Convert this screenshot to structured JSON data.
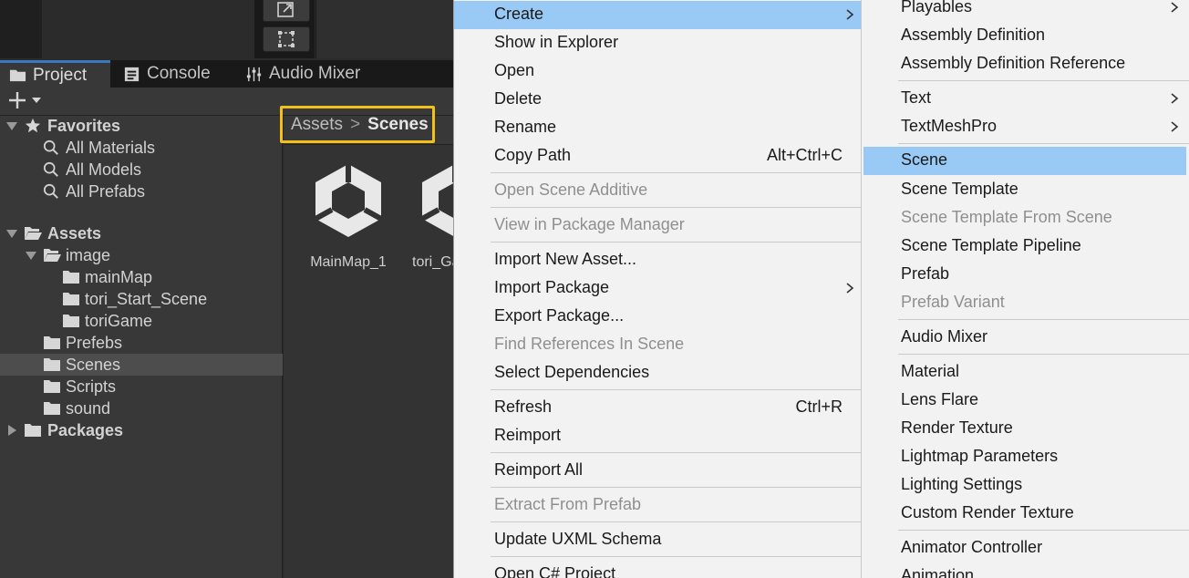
{
  "tabs": [
    {
      "label": "Project",
      "icon": "folder-icon",
      "active": true
    },
    {
      "label": "Console",
      "icon": "console-icon",
      "active": false
    },
    {
      "label": "Audio Mixer",
      "icon": "sliders-icon",
      "active": false
    }
  ],
  "toolbar": {
    "add_label": "+"
  },
  "tree": {
    "favorites": {
      "label": "Favorites",
      "items": [
        "All Materials",
        "All Models",
        "All Prefabs"
      ]
    },
    "assets": {
      "label": "Assets"
    },
    "image": {
      "label": "image",
      "children": [
        "mainMap",
        "tori_Start_Scene",
        "toriGame"
      ]
    },
    "folders": [
      "Prefebs",
      "Scenes",
      "Scripts",
      "sound"
    ],
    "selected": "Scenes",
    "packages": {
      "label": "Packages"
    }
  },
  "breadcrumb": {
    "root": "Assets",
    "separator": ">",
    "current": "Scenes"
  },
  "assets_grid": [
    {
      "name": "MainMap_1",
      "icon": "unity-scene-icon"
    },
    {
      "name": "tori_Ga",
      "icon": "unity-scene-icon"
    }
  ],
  "context_menu": {
    "items": [
      {
        "label": "Create",
        "highlighted": true,
        "submenu": true
      },
      {
        "label": "Show in Explorer"
      },
      {
        "label": "Open"
      },
      {
        "label": "Delete"
      },
      {
        "label": "Rename"
      },
      {
        "label": "Copy Path",
        "shortcut": "Alt+Ctrl+C"
      },
      {
        "label": "Open Scene Additive",
        "disabled": true
      },
      {
        "label": "View in Package Manager",
        "disabled": true
      },
      {
        "label": "Import New Asset..."
      },
      {
        "label": "Import Package",
        "submenu": true
      },
      {
        "label": "Export Package..."
      },
      {
        "label": "Find References In Scene",
        "disabled": true
      },
      {
        "label": "Select Dependencies"
      },
      {
        "label": "Refresh",
        "shortcut": "Ctrl+R"
      },
      {
        "label": "Reimport"
      },
      {
        "label": "Reimport All"
      },
      {
        "label": "Extract From Prefab",
        "disabled": true
      },
      {
        "label": "Update UXML Schema"
      },
      {
        "label": "Open C# Project"
      }
    ]
  },
  "create_submenu": {
    "items": [
      {
        "label": "Playables",
        "submenu": true
      },
      {
        "label": "Assembly Definition"
      },
      {
        "label": "Assembly Definition Reference"
      },
      {
        "label": "Text",
        "submenu": true
      },
      {
        "label": "TextMeshPro",
        "submenu": true
      },
      {
        "label": "Scene",
        "highlighted": true
      },
      {
        "label": "Scene Template"
      },
      {
        "label": "Scene Template From Scene",
        "disabled": true
      },
      {
        "label": "Scene Template Pipeline"
      },
      {
        "label": "Prefab"
      },
      {
        "label": "Prefab Variant",
        "disabled": true
      },
      {
        "label": "Audio Mixer"
      },
      {
        "label": "Material"
      },
      {
        "label": "Lens Flare"
      },
      {
        "label": "Render Texture"
      },
      {
        "label": "Lightmap Parameters"
      },
      {
        "label": "Lighting Settings"
      },
      {
        "label": "Custom Render Texture"
      },
      {
        "label": "Animator Controller"
      },
      {
        "label": "Animation"
      }
    ]
  },
  "colors": {
    "highlight": "#99c9f5",
    "breadcrumb_outline": "#f3c01a",
    "tab_accent": "#3a79bb",
    "menu_bg": "#f2f2f2",
    "panel_bg": "#383838"
  }
}
